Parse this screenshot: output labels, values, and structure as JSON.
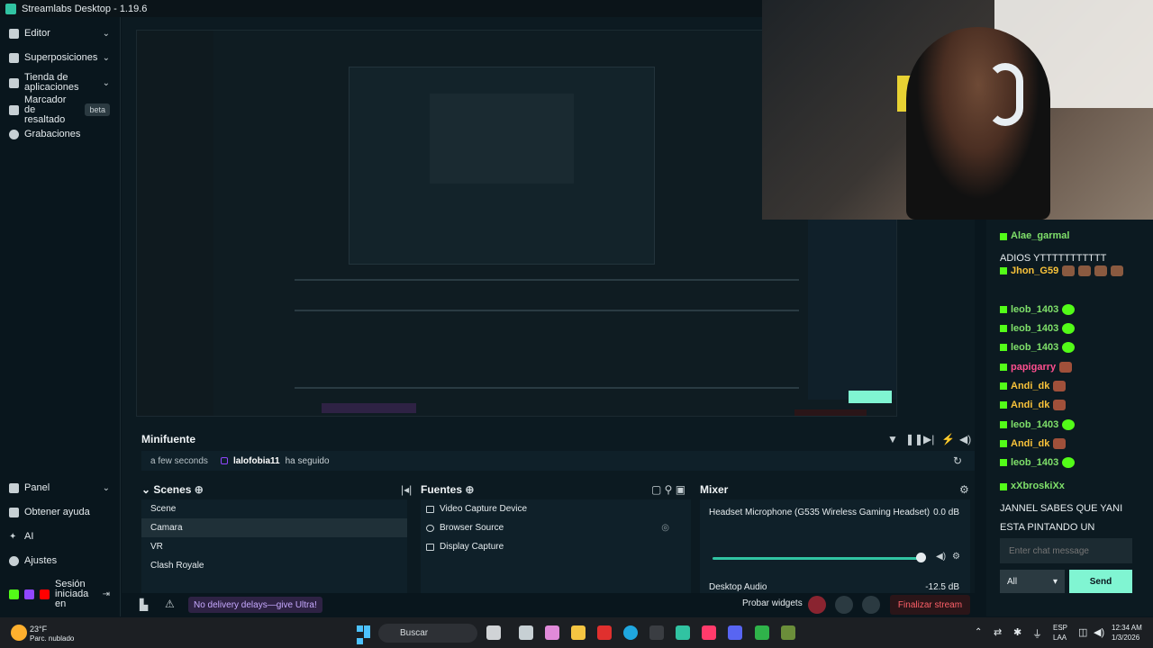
{
  "titlebar": {
    "title": "Streamlabs Desktop - 1.19.6"
  },
  "sidebar": {
    "items": [
      {
        "label": "Editor"
      },
      {
        "label": "Superposiciones"
      },
      {
        "label": "Tienda de aplicaciones"
      },
      {
        "label": "Marcador de resaltado",
        "badge": "beta"
      },
      {
        "label": "Grabaciones"
      }
    ],
    "bottom": [
      {
        "label": "Panel"
      },
      {
        "label": "Obtener ayuda"
      },
      {
        "label": "AI"
      },
      {
        "label": "Ajustes"
      },
      {
        "label": "Sesión iniciada en"
      }
    ]
  },
  "minifuente": {
    "title": "Minifuente",
    "event": {
      "time": "a few seconds",
      "user": "lalofobia11",
      "action": "ha seguido"
    }
  },
  "scenes": {
    "title": "Scenes",
    "items": [
      "Scene",
      "Camara",
      "VR",
      "Clash Royale"
    ],
    "selected": 1
  },
  "sources": {
    "title": "Fuentes",
    "items": [
      "Video Capture Device",
      "Browser Source",
      "Display Capture"
    ]
  },
  "mixer": {
    "title": "Mixer",
    "channels": [
      {
        "name": "Headset Microphone (G535 Wireless Gaming Headset)",
        "db": "0.0 dB",
        "level": 1.0
      },
      {
        "name": "Desktop Audio",
        "db": "-12.5 dB"
      }
    ]
  },
  "footer": {
    "ultra": "No delivery delays—give Ultra!",
    "test_widgets": "Probar widgets",
    "end_stream": "Finalizar stream"
  },
  "chat": {
    "messages": [
      {
        "user": "Alae_garmal",
        "text": "ADIOS YTTTTTTTTTTT"
      },
      {
        "user": "Jhon_G59",
        "text": ""
      },
      {
        "user": "leob_1403",
        "text": ""
      },
      {
        "user": "leob_1403",
        "text": ""
      },
      {
        "user": "leob_1403",
        "text": ""
      },
      {
        "user": "papigarry",
        "text": ""
      },
      {
        "user": "Andi_dk",
        "text": ""
      },
      {
        "user": "Andi_dk",
        "text": ""
      },
      {
        "user": "leob_1403",
        "text": ""
      },
      {
        "user": "Andi_dk",
        "text": ""
      },
      {
        "user": "leob_1403",
        "text": ""
      },
      {
        "user": "xXbroskiXx",
        "text": "JANNEL SABES QUE YANI ESTA PINTANDO UN CUADRO?"
      }
    ],
    "input_placeholder": "Enter chat message",
    "filter": "All",
    "send_label": "Send"
  },
  "taskbar": {
    "weather_temp": "23°F",
    "weather_desc": "Parc. nublado",
    "search": "Buscar",
    "lang": "ESP",
    "region": "LAA",
    "time": "12:34 AM",
    "date": "1/3/2026"
  }
}
